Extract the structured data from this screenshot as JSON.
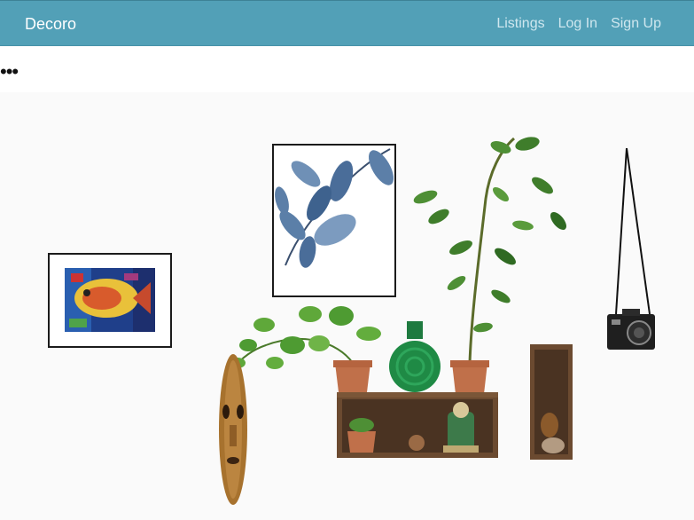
{
  "navbar": {
    "brand": "Decoro",
    "links": [
      "Listings",
      "Log In",
      "Sign Up"
    ]
  },
  "toolbar": {
    "more_label": "•••"
  },
  "hero": {
    "image_name": "wall-decor-photo"
  },
  "colors": {
    "navbar_bg": "#52a0b7",
    "brand_text": "#ffffff",
    "link_text": "#cfe7ef"
  }
}
